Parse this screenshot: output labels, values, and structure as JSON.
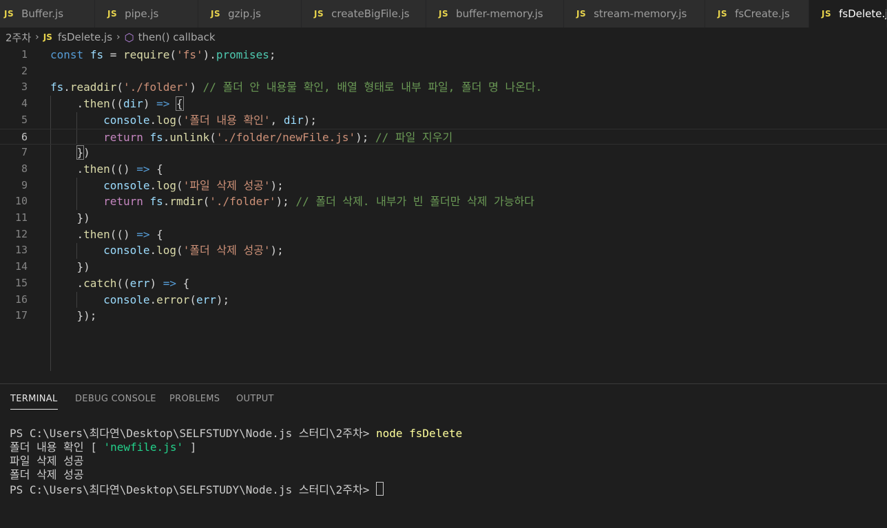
{
  "tabs": [
    {
      "label": "Buffer.js",
      "badge": "JS"
    },
    {
      "label": "pipe.js",
      "badge": "JS"
    },
    {
      "label": "gzip.js",
      "badge": "JS"
    },
    {
      "label": "createBigFile.js",
      "badge": "JS"
    },
    {
      "label": "buffer-memory.js",
      "badge": "JS"
    },
    {
      "label": "stream-memory.js",
      "badge": "JS"
    },
    {
      "label": "fsCreate.js",
      "badge": "JS"
    },
    {
      "label": "fsDelete.js",
      "badge": "JS",
      "active": true
    }
  ],
  "breadcrumb": {
    "folder": "2주차",
    "file_badge": "JS",
    "file": "fsDelete.js",
    "symbol": "then() callback"
  },
  "editor": {
    "current_line": 6,
    "lines": [
      {
        "n": "1"
      },
      {
        "n": "2"
      },
      {
        "n": "3"
      },
      {
        "n": "4"
      },
      {
        "n": "5"
      },
      {
        "n": "6"
      },
      {
        "n": "7"
      },
      {
        "n": "8"
      },
      {
        "n": "9"
      },
      {
        "n": "10"
      },
      {
        "n": "11"
      },
      {
        "n": "12"
      },
      {
        "n": "13"
      },
      {
        "n": "14"
      },
      {
        "n": "15"
      },
      {
        "n": "16"
      },
      {
        "n": "17"
      }
    ],
    "tokens": {
      "const": "const",
      "fs": "fs",
      "eq": " = ",
      "require": "require",
      "fsmod": "'fs'",
      "promises": "promises",
      "readdir": "readdir",
      "folder_path": "'./folder'",
      "comment3": "// 폴더 안 내용물 확인, 배열 형태로 내부 파일, 폴더 명 나온다.",
      "then": "then",
      "dir": "dir",
      "arrow": "=>",
      "console": "console",
      "log": "log",
      "msg5": "'폴더 내용 확인'",
      "return": "return",
      "unlink": "unlink",
      "newfile_path": "'./folder/newFile.js'",
      "comment6": "// 파일 지우기",
      "msg9": "'파일 삭제 성공'",
      "rmdir": "rmdir",
      "comment10": "// 폴더 삭제. 내부가 빈 폴더만 삭제 가능하다",
      "msg13": "'폴더 삭제 성공'",
      "catch": "catch",
      "err": "err",
      "error": "error"
    }
  },
  "panel": {
    "tabs": [
      "TERMINAL",
      "DEBUG CONSOLE",
      "PROBLEMS",
      "OUTPUT"
    ],
    "active_tab": "TERMINAL",
    "terminal": {
      "prompt": "PS C:\\Users\\최다연\\Desktop\\SELFSTUDY\\Node.js 스터디\\2주차> ",
      "command": "node fsDelete",
      "out1_prefix": "폴더 내용 확인 [ ",
      "out1_value": "'newfile.js'",
      "out1_suffix": " ]",
      "out2": "파일 삭제 성공",
      "out3": "폴더 삭제 성공",
      "prompt2": "PS C:\\Users\\최다연\\Desktop\\SELFSTUDY\\Node.js 스터디\\2주차> "
    }
  },
  "colors": {
    "editor_bg": "#1e1e1e",
    "tab_inactive": "#2d2d2d",
    "js_badge": "#e8d44d",
    "keyword": "#569cd6",
    "control": "#c586c0",
    "variable": "#9cdcfe",
    "function": "#dcdcaa",
    "string": "#ce9178",
    "comment": "#6a9955",
    "terminal_command": "#ffff9c",
    "terminal_string": "#23d18b"
  }
}
